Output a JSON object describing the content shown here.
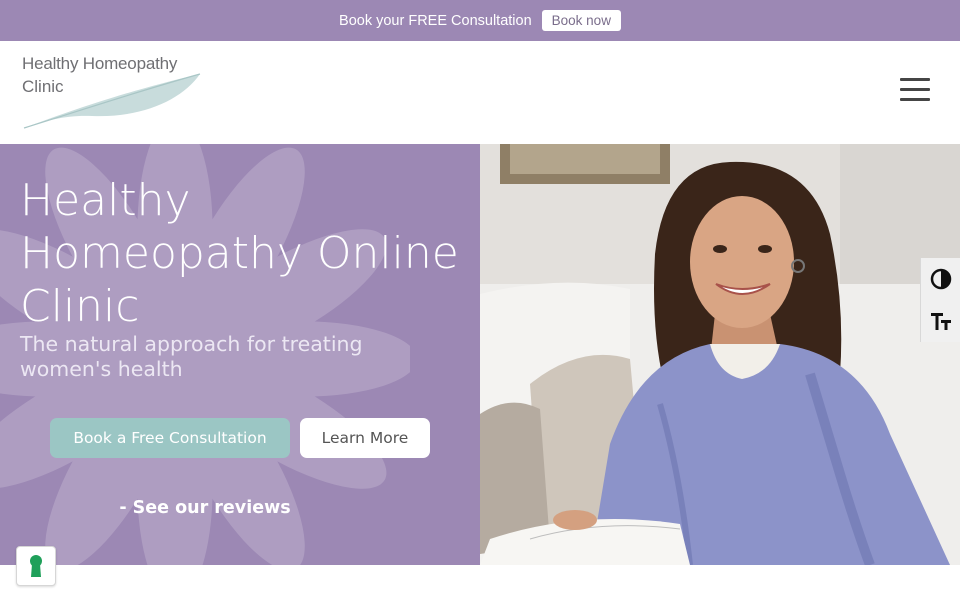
{
  "topbar": {
    "text": "Book your FREE Consultation",
    "button_label": "Book now"
  },
  "header": {
    "logo_line1": "Healthy Homeopathy",
    "logo_line2": "Clinic",
    "menu_icon": "hamburger-menu-icon"
  },
  "hero": {
    "title": "Healthy Homeopathy Online Clinic",
    "subtitle": "The natural approach for treating women's health",
    "primary_button": "Book a Free Consultation",
    "secondary_button": "Learn More",
    "reviews_link": "- See our reviews",
    "photo_icon": "smiling-woman-photo"
  },
  "accessibility": {
    "contrast_icon": "contrast-toggle-icon",
    "font_size_icon": "font-size-icon"
  },
  "cookie_badge": {
    "icon": "keyhole-icon"
  },
  "colors": {
    "brand_purple": "#9c88b4",
    "accent_teal": "#9bc6c4",
    "cookie_green": "#1fa05a"
  }
}
